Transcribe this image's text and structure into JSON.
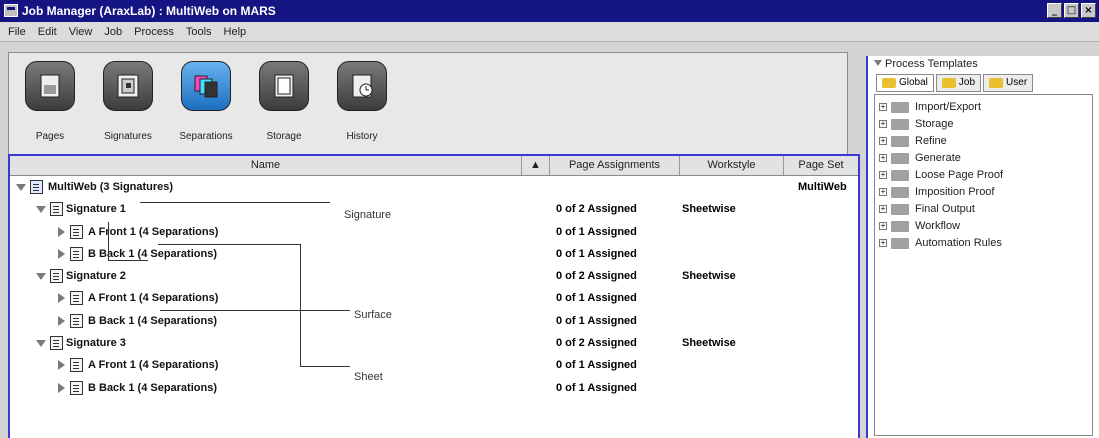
{
  "window": {
    "title": "Job Manager (AraxLab) : MultiWeb on MARS",
    "controls": [
      "_",
      "□",
      "×"
    ]
  },
  "menu": [
    "File",
    "Edit",
    "View",
    "Job",
    "Process",
    "Tools",
    "Help"
  ],
  "toolbar": {
    "items": [
      {
        "label": "Pages",
        "icon": "pages-icon",
        "active": false
      },
      {
        "label": "Signatures",
        "icon": "signatures-icon",
        "active": false
      },
      {
        "label": "Separations",
        "icon": "separations-icon",
        "active": true
      },
      {
        "label": "Storage",
        "icon": "storage-icon",
        "active": false
      },
      {
        "label": "History",
        "icon": "history-icon",
        "active": false
      }
    ]
  },
  "table": {
    "columns": {
      "name": "Name",
      "sort": "▲",
      "page_assignments": "Page Assignments",
      "workstyle": "Workstyle",
      "page_set": "Page Set"
    },
    "rows": [
      {
        "level": 0,
        "text": "MultiWeb (3 Signatures)",
        "expanded": true,
        "pa": "",
        "ws": "",
        "ps": "MultiWeb"
      },
      {
        "level": 1,
        "text": "Signature 1",
        "expanded": true,
        "pa": "0 of 2 Assigned",
        "ws": "Sheetwise",
        "ps": ""
      },
      {
        "level": 2,
        "text": "A Front 1 (4 Separations)",
        "expanded": false,
        "pa": "0 of 1 Assigned",
        "ws": "",
        "ps": ""
      },
      {
        "level": 2,
        "text": "B Back 1 (4 Separations)",
        "expanded": false,
        "pa": "0 of 1 Assigned",
        "ws": "",
        "ps": ""
      },
      {
        "level": 1,
        "text": "Signature 2",
        "expanded": true,
        "pa": "0 of 2 Assigned",
        "ws": "Sheetwise",
        "ps": ""
      },
      {
        "level": 2,
        "text": "A Front 1 (4 Separations)",
        "expanded": false,
        "pa": "0 of 1 Assigned",
        "ws": "",
        "ps": ""
      },
      {
        "level": 2,
        "text": "B Back 1 (4 Separations)",
        "expanded": false,
        "pa": "0 of 1 Assigned",
        "ws": "",
        "ps": ""
      },
      {
        "level": 1,
        "text": "Signature 3",
        "expanded": true,
        "pa": "0 of 2 Assigned",
        "ws": "Sheetwise",
        "ps": ""
      },
      {
        "level": 2,
        "text": "A Front 1 (4 Separations)",
        "expanded": false,
        "pa": "0 of 1 Assigned",
        "ws": "",
        "ps": ""
      },
      {
        "level": 2,
        "text": "B Back 1 (4 Separations)",
        "expanded": false,
        "pa": "0 of 1 Assigned",
        "ws": "",
        "ps": ""
      }
    ]
  },
  "callouts": {
    "signature": "Signature",
    "surface": "Surface",
    "sheet": "Sheet"
  },
  "process_templates": {
    "title": "Process Templates",
    "tabs": [
      {
        "label": "Global",
        "active": true
      },
      {
        "label": "Job",
        "active": false
      },
      {
        "label": "User",
        "active": false
      }
    ],
    "items": [
      "Import/Export",
      "Storage",
      "Refine",
      "Generate",
      "Loose Page Proof",
      "Imposition Proof",
      "Final Output",
      "Workflow",
      "Automation Rules"
    ]
  },
  "colors": {
    "title_bar": "#141482",
    "selection_border": "#3a3ad0",
    "active_tool": "#1c6fc0"
  }
}
